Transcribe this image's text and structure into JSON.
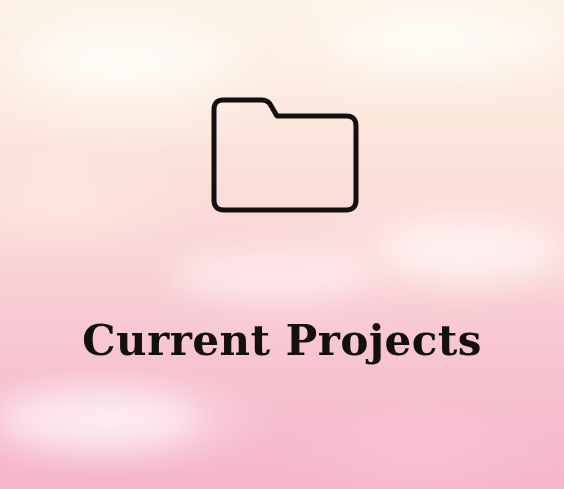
{
  "card": {
    "title": "Current Projects",
    "icon": "folder-icon"
  },
  "colors": {
    "text": "#141010",
    "background_top": "#fdf2e6",
    "background_bottom": "#f5b7ca"
  }
}
